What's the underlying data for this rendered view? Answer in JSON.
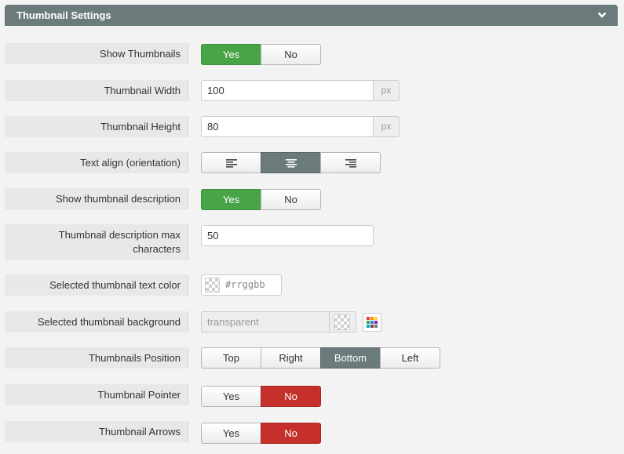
{
  "panel": {
    "title": "Thumbnail Settings",
    "toggle_icon": "chevron-down-icon"
  },
  "show_thumbnails": {
    "label": "Show Thumbnails",
    "yes": "Yes",
    "no": "No",
    "selected": "Yes"
  },
  "thumbnail_width": {
    "label": "Thumbnail Width",
    "value": "100",
    "unit": "px"
  },
  "thumbnail_height": {
    "label": "Thumbnail Height",
    "value": "80",
    "unit": "px"
  },
  "text_align": {
    "label": "Text align (orientation)",
    "options": [
      "align-left-icon",
      "align-center-icon",
      "align-right-icon"
    ],
    "selected": "align-center-icon"
  },
  "show_description": {
    "label": "Show thumbnail description",
    "yes": "Yes",
    "no": "No",
    "selected": "Yes"
  },
  "description_max": {
    "label_line1": "Thumbnail description max",
    "label_line2": "characters",
    "value": "50"
  },
  "selected_text_color": {
    "label": "Selected thumbnail text color",
    "placeholder": "#rrggbb"
  },
  "selected_background": {
    "label": "Selected thumbnail background",
    "value": "transparent",
    "picker_icon": "color-palette-icon"
  },
  "thumbnails_position": {
    "label": "Thumbnails Position",
    "options": [
      "Top",
      "Right",
      "Bottom",
      "Left"
    ],
    "selected": "Bottom"
  },
  "thumbnail_pointer": {
    "label": "Thumbnail Pointer",
    "yes": "Yes",
    "no": "No",
    "selected": "No"
  },
  "thumbnail_arrows": {
    "label": "Thumbnail Arrows",
    "yes": "Yes",
    "no": "No",
    "selected": "No"
  },
  "colors": {
    "header": "#6b7a7a",
    "yes_active": "#47a447",
    "no_active": "#c6302b",
    "option_active": "#6b7a7a"
  }
}
